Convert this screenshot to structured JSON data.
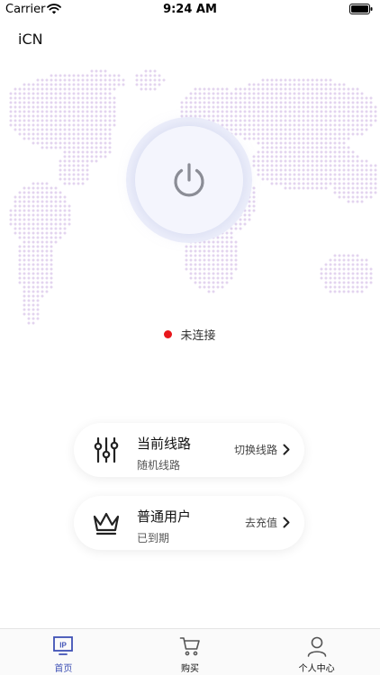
{
  "status_bar": {
    "carrier": "Carrier",
    "time": "9:24 AM"
  },
  "app": {
    "title": "iCN"
  },
  "connection": {
    "status_text": "未连接",
    "status_color": "#e8171c"
  },
  "route_card": {
    "title": "当前线路",
    "subtitle": "随机线路",
    "action": "切换线路"
  },
  "plan_card": {
    "title": "普通用户",
    "subtitle": "已到期",
    "action": "去充值"
  },
  "tabs": [
    {
      "label": "首页",
      "icon": "ip-icon",
      "active": true
    },
    {
      "label": "购买",
      "icon": "cart-icon",
      "active": false
    },
    {
      "label": "个人中心",
      "icon": "user-icon",
      "active": false
    }
  ],
  "colors": {
    "accent": "#3f51b5",
    "map_dots": "#d9c6ea",
    "power_icon": "#8b8d96"
  }
}
